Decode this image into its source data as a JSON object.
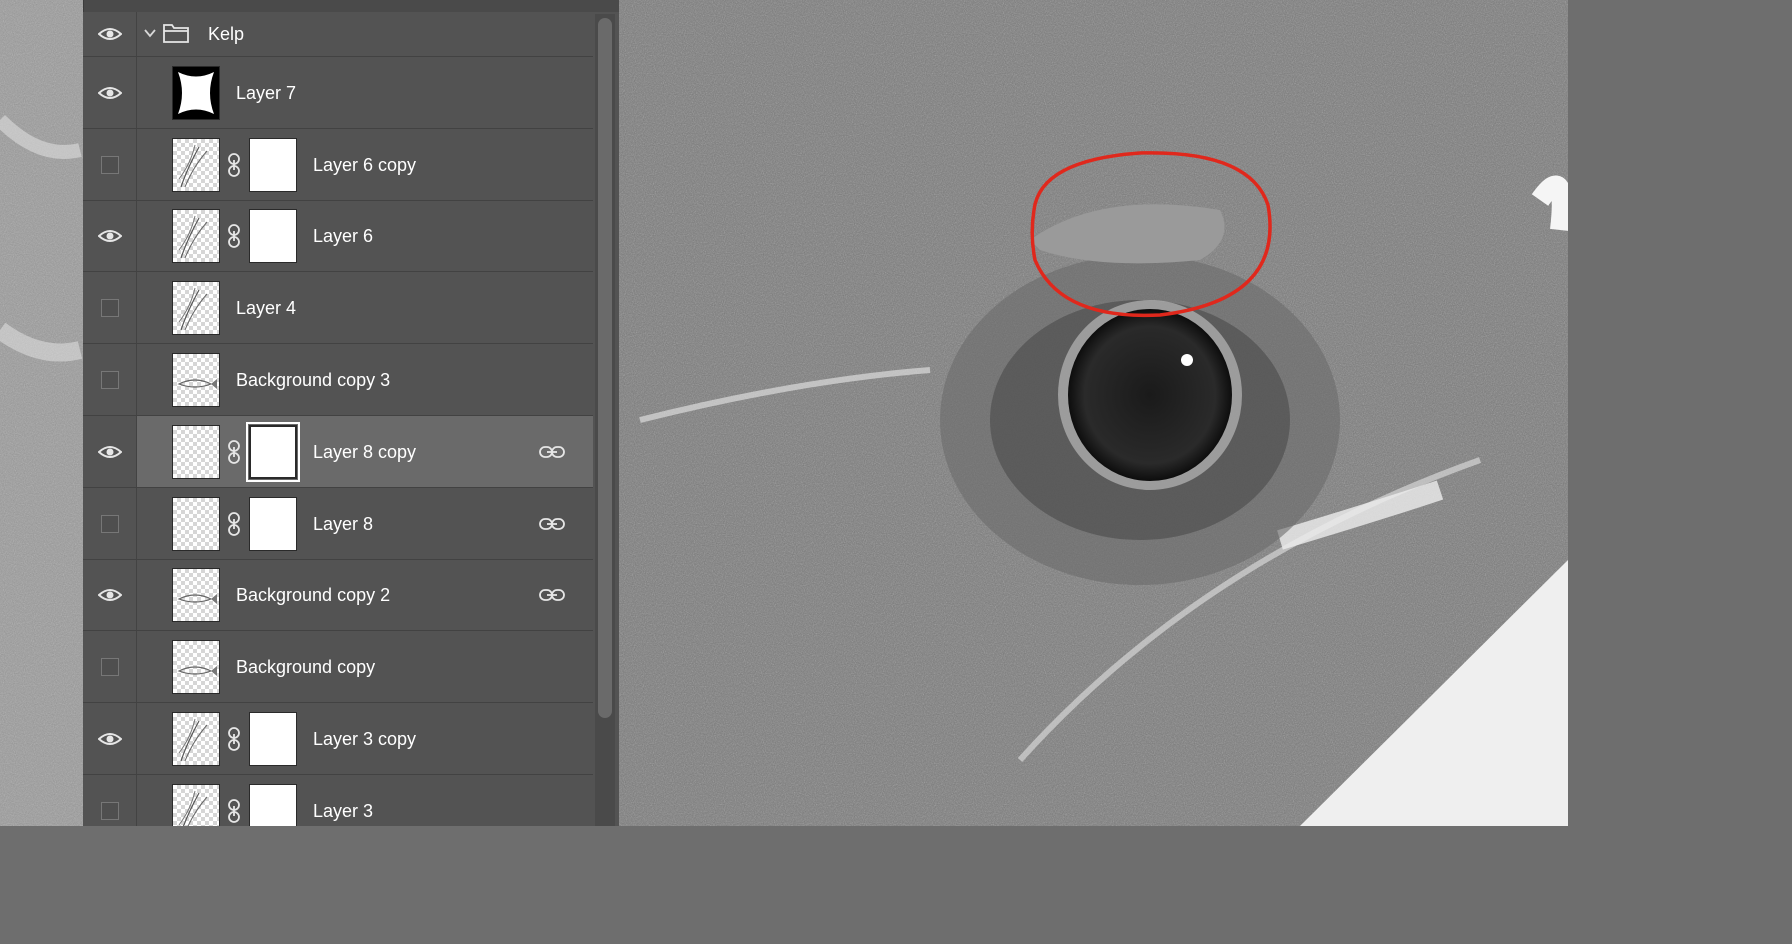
{
  "layers_panel": {
    "group": {
      "name": "Kelp",
      "visible": true,
      "expanded": true
    },
    "layers": [
      {
        "name": "Layer 7",
        "visible": true,
        "thumb": "black-shape",
        "mask": false,
        "link": false,
        "selected": false
      },
      {
        "name": "Layer 6 copy",
        "visible": false,
        "thumb": "kelp",
        "mask": true,
        "link": false,
        "selected": false
      },
      {
        "name": "Layer 6",
        "visible": true,
        "thumb": "kelp",
        "mask": true,
        "link": false,
        "selected": false
      },
      {
        "name": "Layer 4",
        "visible": false,
        "thumb": "kelp",
        "mask": false,
        "link": false,
        "selected": false
      },
      {
        "name": "Background copy 3",
        "visible": false,
        "thumb": "fish",
        "mask": false,
        "link": false,
        "selected": false
      },
      {
        "name": "Layer 8 copy",
        "visible": true,
        "thumb": "transparent",
        "mask": true,
        "link": true,
        "selected": true
      },
      {
        "name": "Layer 8",
        "visible": false,
        "thumb": "transparent",
        "mask": true,
        "link": true,
        "selected": false
      },
      {
        "name": "Background copy 2",
        "visible": true,
        "thumb": "fish",
        "mask": false,
        "link": true,
        "selected": false
      },
      {
        "name": "Background copy",
        "visible": false,
        "thumb": "fish",
        "mask": false,
        "link": false,
        "selected": false
      },
      {
        "name": "Layer 3 copy",
        "visible": true,
        "thumb": "kelp",
        "mask": true,
        "link": false,
        "selected": false
      },
      {
        "name": "Layer 3",
        "visible": false,
        "thumb": "kelp",
        "mask": true,
        "link": false,
        "selected": false
      }
    ]
  },
  "canvas": {
    "content": "grayscale fish eye close-up",
    "annotation": "red ellipse",
    "annotation_color": "#e0281c"
  }
}
